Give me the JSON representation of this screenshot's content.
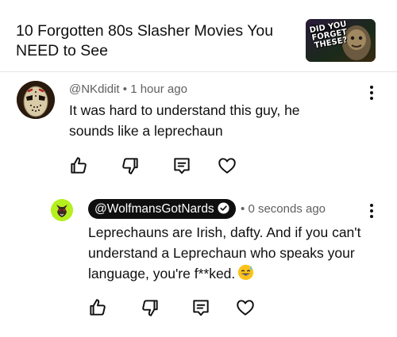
{
  "video": {
    "title": "10 Forgotten 80s Slasher Movies You NEED to See",
    "thumbnail_text": "DID YOU FORGET THESE?"
  },
  "comments": [
    {
      "handle": "@NKdidit",
      "separator": "•",
      "time": "1 hour ago",
      "text": "It was hard to understand this guy, he sounds like a leprechaun",
      "avatar_icon": "hockey-mask-avatar"
    }
  ],
  "reply": {
    "handle": "@WolfmansGotNards",
    "separator": "•",
    "time": "0 seconds ago",
    "text": "Leprechauns are Irish, dafty. And if you can't understand a Leprechaun who speaks your language, you're f**ked.",
    "emoji": "sweat-smile-emoji",
    "avatar_icon": "wolf-avatar",
    "avatar_color": "#b5f01e",
    "pill_color": "#0f0f0f"
  },
  "actions": [
    "like-icon",
    "dislike-icon",
    "reply-icon",
    "heart-icon"
  ]
}
